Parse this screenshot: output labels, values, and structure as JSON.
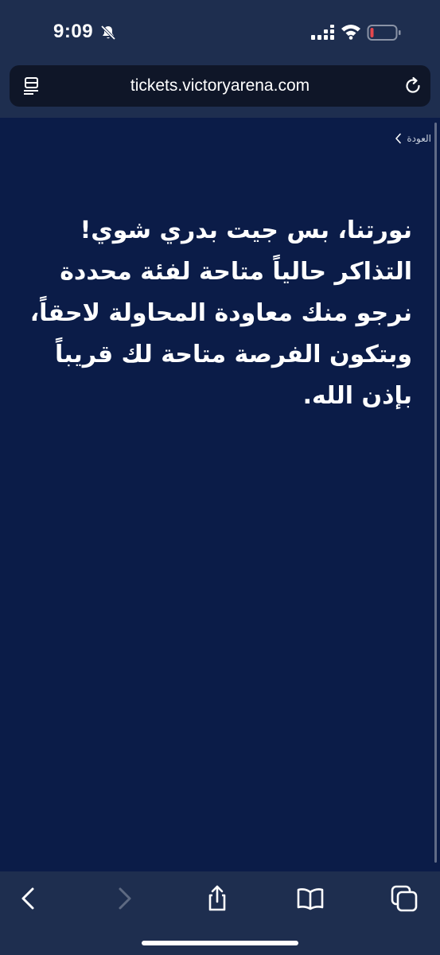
{
  "status_bar": {
    "time": "9:09"
  },
  "browser": {
    "url": "tickets.victoryarena.com"
  },
  "page": {
    "back_label": "العودة",
    "message": "نورتنا، بس جيت بدري شوي! التذاكر حالياً متاحة لفئة محددة نرجو منك معاودة المحاولة لاحقاً، وبتكون الفرصة متاحة لك قريباً بإذن الله."
  },
  "colors": {
    "chrome_background": "#1e2e4f",
    "page_background": "#0b1c48",
    "url_field_background": "#0f1628",
    "battery_low": "#e5484d"
  },
  "icons": {
    "status": [
      "mute-icon",
      "signal-icon",
      "wifi-icon",
      "battery-icon"
    ],
    "url_bar": [
      "reader-icon",
      "reload-icon"
    ],
    "toolbar": [
      "back-arrow-icon",
      "forward-arrow-icon",
      "share-icon",
      "bookmarks-icon",
      "tabs-icon"
    ]
  }
}
